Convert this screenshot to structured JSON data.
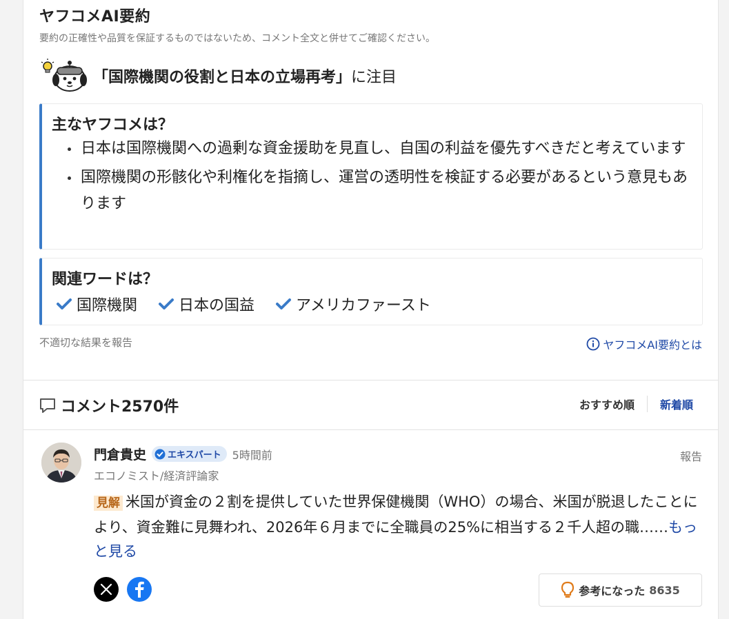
{
  "ai_summary": {
    "title": "ヤフコメAI要約",
    "disclaimer": "要約の正確性や品質を保証するものではないため、コメント全文と併せてご確認ください。",
    "focus_topic": "「国際機関の役割と日本の立場再考」",
    "focus_suffix": "に注目",
    "main_title": "主なヤフコメは？",
    "main_points": [
      "日本は国際機関への過剰な資金援助を見直し、自国の利益を優先すべきだと考えています",
      "国際機関の形骸化や利権化を指摘し、運営の透明性を検証する必要があるという意見もあります"
    ],
    "related_title": "関連ワードは？",
    "related_words": [
      "国際機関",
      "日本の国益",
      "アメリカファースト"
    ],
    "report_link": "不適切な結果を報告",
    "about_link": "ヤフコメAI要約とは"
  },
  "comments": {
    "title": "コメント2570件",
    "sort_recommended": "おすすめ順",
    "sort_newest": "新着順"
  },
  "comment": {
    "author": "門倉貴史",
    "badge": "エキスパート",
    "time": "5時間前",
    "report": "報告",
    "role": "エコノミスト/経済評論家",
    "tag": "見解",
    "body": "米国が資金の２割を提供していた世界保健機関（WHO）の場合、米国が脱退したことにより、資金難に見舞われ、2026年６月までに全職員の25%に相当する２千人超の職……",
    "more": "もっと見る",
    "helpful_label": "参考になった",
    "helpful_count": "8635"
  },
  "colors": {
    "accent_blue": "#3a7bc8",
    "link_blue": "#1f49a6",
    "tag_orange": "#b8671a"
  }
}
